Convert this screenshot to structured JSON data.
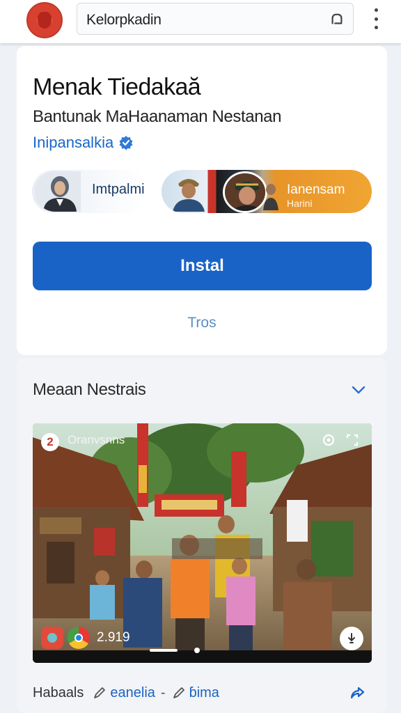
{
  "topbar": {
    "search_value": "Kelorpkadin",
    "logo_icon": "emblem-logo",
    "search_icon": "search-icon",
    "menu_icon": "more-vert-icon"
  },
  "app": {
    "title": "Menak Tiedakaă",
    "subtitle": "Bantunak MaHaanaman Nestanan",
    "developer": "Inipansalkia",
    "chip1_label": "Imtpalmi",
    "chip2_label": "Ianensam",
    "chip2_sublabel": "Harini",
    "install_label": "Instal",
    "more_label": "Tros",
    "accent": "#1a63c6"
  },
  "section": {
    "title": "Meaan Nestrais",
    "media_badge": "2",
    "media_caption": "Oranvsnns",
    "media_count": "2.919"
  },
  "footer": {
    "item1": "Habaals",
    "item2": "eanelia",
    "separator": "-",
    "item3": "ɓima"
  }
}
